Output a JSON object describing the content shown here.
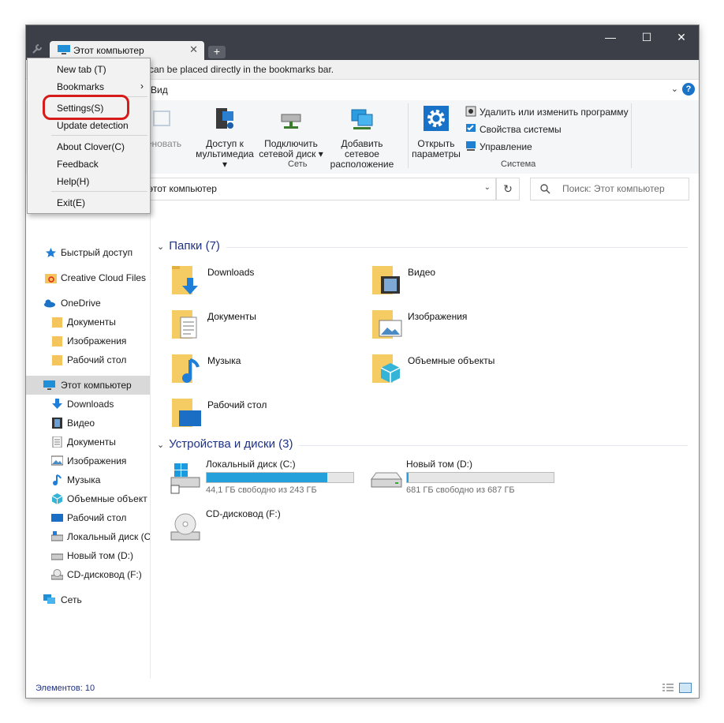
{
  "window": {
    "tab_title": "Этот компьютер",
    "tab_close": "✕",
    "new_tab": "+",
    "minimize": "—",
    "maximize": "☐",
    "close": "✕"
  },
  "bookmarks_bar": {
    "text": "can be placed directly in the bookmarks bar."
  },
  "ribbon_tabs": {
    "view": "Вид",
    "collapse": "⌄",
    "help": "?"
  },
  "ribbon": {
    "rename_partial": "еновать",
    "media_access": [
      "Доступ к",
      "мультимедиа ▾"
    ],
    "map_drive": [
      "Подключить",
      "сетевой диск ▾"
    ],
    "add_location": [
      "Добавить сетевое",
      "расположение"
    ],
    "open_settings": [
      "Открыть",
      "параметры"
    ],
    "uninstall": "Удалить или изменить программу",
    "system_props": "Свойства системы",
    "manage": "Управление",
    "group_network": "Сеть",
    "group_system": "Система"
  },
  "address": {
    "path": "этот компьютер",
    "dropdown": "⌄",
    "refresh": "↻",
    "search_placeholder": "Поиск: Этот компьютер"
  },
  "nav": {
    "quick_access": "Быстрый доступ",
    "creative_cloud": "Creative Cloud Files",
    "onedrive": "OneDrive",
    "od_docs": "Документы",
    "od_images": "Изображения",
    "od_desktop": "Рабочий стол",
    "this_pc": "Этот компьютер",
    "downloads": "Downloads",
    "video": "Видео",
    "docs": "Документы",
    "images": "Изображения",
    "music": "Музыка",
    "objects3d": "Объемные объект",
    "desktop": "Рабочий стол",
    "local_disk": "Локальный диск (С",
    "new_volume": "Новый том (D:)",
    "cd_drive": "CD-дисковод (F:)",
    "network": "Сеть"
  },
  "content": {
    "folders_header": "Папки (7)",
    "devices_header": "Устройства и диски (3)",
    "chevron": "⌄",
    "folders": [
      "Downloads",
      "Видео",
      "Документы",
      "Изображения",
      "Музыка",
      "Объемные объекты",
      "Рабочий стол"
    ],
    "drives": [
      {
        "name": "Локальный диск (C:)",
        "free": "44,1 ГБ свободно из 243 ГБ",
        "used_fraction": 0.82
      },
      {
        "name": "Новый том (D:)",
        "free": "681 ГБ свободно из 687 ГБ",
        "used_fraction": 0.01
      },
      {
        "name": "CD-дисковод (F:)"
      }
    ]
  },
  "status": {
    "items": "Элементов: 10"
  },
  "menu": {
    "new_tab": "New tab (T)",
    "bookmarks": "Bookmarks",
    "arrow": "›",
    "settings": "Settings(S)",
    "update": "Update detection",
    "about": "About Clover(C)",
    "feedback": "Feedback",
    "help": "Help(H)",
    "exit": "Exit(E)"
  },
  "colors": {
    "titlebar": "#3c3f47",
    "accent": "#26a0da",
    "highlight": "#d71a1a",
    "section_text": "#1e3287"
  }
}
